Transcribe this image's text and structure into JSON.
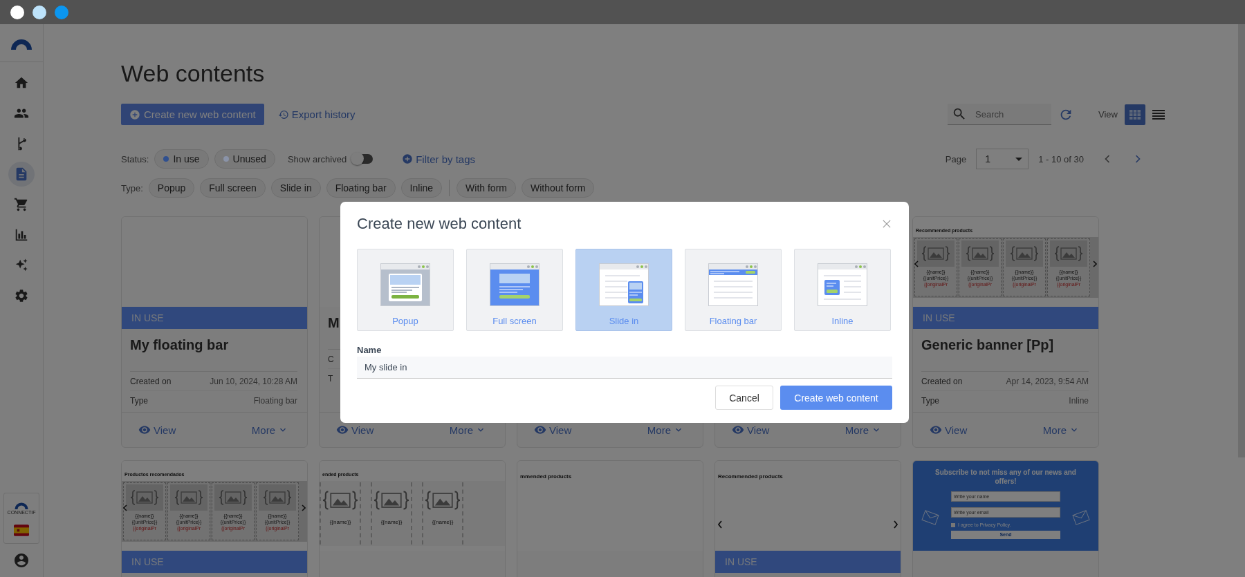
{
  "sidebar": {
    "items": [
      {
        "selected": false
      },
      {
        "selected": false
      },
      {
        "selected": false
      },
      {
        "selected": true
      },
      {
        "selected": false
      },
      {
        "selected": false
      },
      {
        "selected": false
      },
      {
        "selected": false
      }
    ],
    "brand": "CONNECTIF"
  },
  "page": {
    "title": "Web contents"
  },
  "toolbar": {
    "create_button": "Create new web content",
    "export_link": "Export history",
    "search": {
      "placeholder": "Search"
    },
    "view_label": "View",
    "views": [
      {
        "selected": true
      },
      {
        "selected": false
      }
    ]
  },
  "filters": {
    "status_label": "Status:",
    "statuses": [
      {
        "label": "In use",
        "color": "#30508f"
      },
      {
        "label": "Unused",
        "color": "#8a93a8"
      }
    ],
    "show_archived": {
      "label": "Show archived",
      "on": false
    },
    "filter_tags": "Filter by tags",
    "type_label": "Type:",
    "types": [
      "Popup",
      "Full screen",
      "Slide in",
      "Floating bar",
      "Inline"
    ],
    "form_types": [
      "With form",
      "Without form"
    ]
  },
  "pagination": {
    "label": "Page",
    "page": "1",
    "range": "1 - 10 of 30"
  },
  "cards": [
    {
      "preview": {
        "kind": "blank"
      },
      "status": "IN USE",
      "title": "My floating bar",
      "created_label": "Created on",
      "created": "Jun 10, 2024, 10:28 AM",
      "type_label": "Type",
      "type": "Floating bar",
      "view": "View",
      "more": "More"
    },
    {
      "preview": {
        "kind": "blank"
      },
      "title": "M",
      "created_label": "C",
      "type_label": "T",
      "view": "View",
      "more": "More"
    },
    {
      "preview": {
        "kind": "blank"
      },
      "view": "View",
      "more": "More"
    },
    {
      "preview": {
        "kind": "blank"
      },
      "view": "View",
      "more": "More"
    },
    {
      "preview": {
        "kind": "carousel",
        "heading": "Recommended products",
        "items": [
          {
            "name": "{{name}}",
            "price": "{{unitPrice}}",
            "original": "{{originalPr"
          },
          {
            "name": "{{name}}",
            "price": "{{unitPrice}}",
            "original": "{{originalPr"
          },
          {
            "name": "{{name}}",
            "price": "{{unitPrice}}",
            "original": "{{originalPr"
          },
          {
            "name": "{{name}}",
            "price": "{{unitPrice}}",
            "original": "{{originalPr"
          }
        ]
      },
      "status": "IN USE",
      "title": "Generic banner [Pp]",
      "created_label": "Created on",
      "created": "Apr 14, 2023, 9:54 AM",
      "type_label": "Type",
      "type": "Inline",
      "view": "View",
      "more": "More"
    },
    {
      "preview": {
        "kind": "carousel",
        "heading": "Productos recomendados",
        "items": [
          {
            "name": "{{name}}",
            "price": "{{unitPrice}}",
            "original": "{{originalPr"
          },
          {
            "name": "{{name}}",
            "price": "{{unitPrice}}",
            "original": "{{originalPr"
          },
          {
            "name": "{{name}}",
            "price": "{{unitPrice}}",
            "original": "{{originalPr"
          },
          {
            "name": "{{name}}",
            "price": "{{unitPrice}}",
            "original": "{{originalPr"
          }
        ]
      },
      "status": "IN USE"
    },
    {
      "preview": {
        "kind": "large",
        "heading": "ended products",
        "items": [
          {
            "name": "{{name}}"
          },
          {
            "name": "{{name}}"
          },
          {
            "name": "{{name}}"
          }
        ]
      }
    },
    {
      "preview": {
        "kind": "heading",
        "heading": "mmended products"
      }
    },
    {
      "preview": {
        "kind": "slider",
        "heading": "Recommended products"
      },
      "status": "IN USE"
    },
    {
      "preview": {
        "kind": "subscribe",
        "heading": "Subscribe to not miss any of our news and offers!",
        "fields": [
          "Write your name",
          "Write your email"
        ],
        "consent": "I agree to Privacy Policy.",
        "consent_checked": false,
        "button": "Send"
      }
    }
  ],
  "modal": {
    "title": "Create new web content",
    "options": [
      {
        "label": "Popup",
        "selected": false
      },
      {
        "label": "Full screen",
        "selected": false
      },
      {
        "label": "Slide in",
        "selected": true
      },
      {
        "label": "Floating bar",
        "selected": false
      },
      {
        "label": "Inline",
        "selected": false
      }
    ],
    "name_label": "Name",
    "name_value": "My slide in",
    "cancel": "Cancel",
    "create": "Create web content"
  }
}
